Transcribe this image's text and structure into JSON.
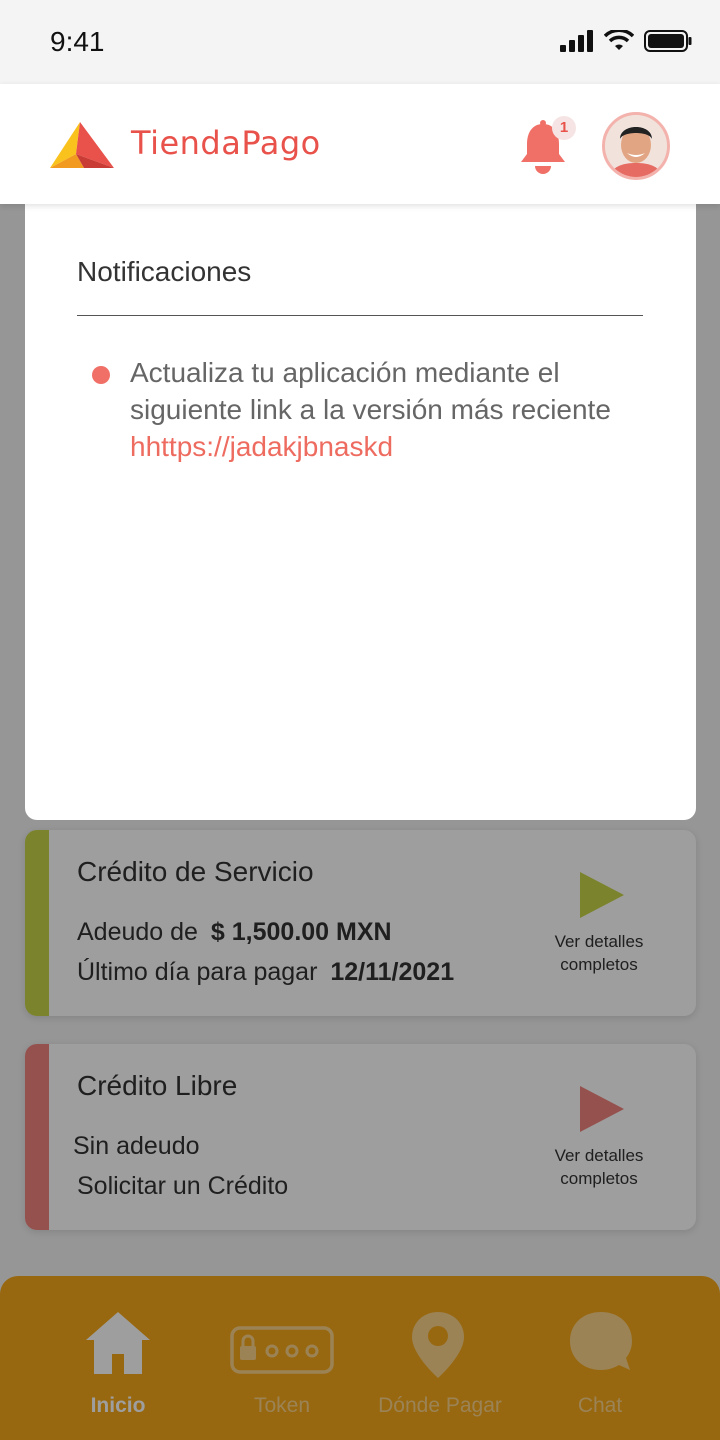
{
  "status_bar": {
    "time": "9:41"
  },
  "header": {
    "app_name": "TiendaPago",
    "notification_count": "1"
  },
  "notifications": {
    "title": "Notificaciones",
    "items": [
      {
        "text": "Actualiza tu aplicación mediante el siguiente link a la versión más reciente ",
        "link": "hhttps://jadakjbnaskd"
      }
    ]
  },
  "cards": [
    {
      "title": "Crédito de Servicio",
      "line1_label": "Adeudo de",
      "line1_value": "$ 1,500.00 MXN",
      "line2_label": "Último día para pagar",
      "line2_value": "12/11/2021",
      "details": "Ver detalles completos",
      "accent": "#c8d44a"
    },
    {
      "title": "Crédito Libre",
      "line1_label": "Sin adeudo",
      "line2_label": "Solicitar un Crédito",
      "details": "Ver detalles completos",
      "accent": "#f0837d"
    }
  ],
  "bottom_nav": {
    "items": [
      {
        "label": "Inicio",
        "icon": "home-icon",
        "active": true
      },
      {
        "label": "Token",
        "icon": "token-icon",
        "active": false
      },
      {
        "label": "Dónde Pagar",
        "icon": "location-pin-icon",
        "active": false
      },
      {
        "label": "Chat",
        "icon": "chat-icon",
        "active": false
      }
    ]
  },
  "colors": {
    "brand": "#e8524a",
    "nav_background": "#f6a81b",
    "service_accent": "#c8d44a",
    "free_accent": "#f0837d"
  }
}
